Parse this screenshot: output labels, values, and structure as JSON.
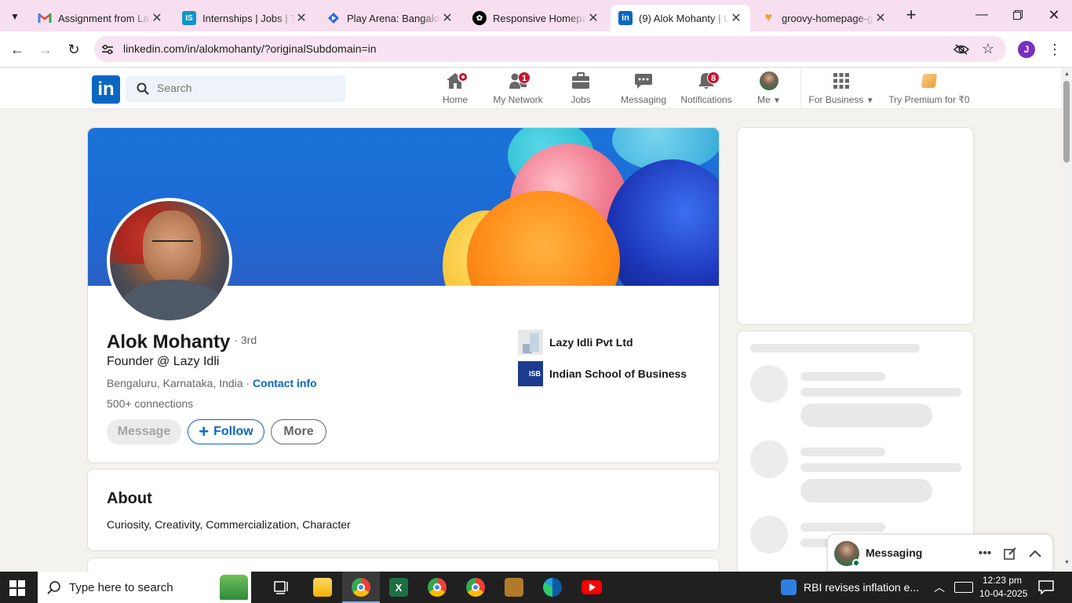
{
  "browser": {
    "tabs": [
      {
        "title": "Assignment from Lazy",
        "favicon": "gmail-icon"
      },
      {
        "title": "Internships | Jobs | Tra",
        "favicon": "internshala-icon"
      },
      {
        "title": "Play Arena: Bangalore",
        "favicon": "playarena-icon"
      },
      {
        "title": "Responsive Homepag",
        "favicon": "chatgpt-icon"
      },
      {
        "title": "(9) Alok Mohanty | Li",
        "favicon": "linkedin-icon",
        "active": true
      },
      {
        "title": "groovy-homepage-g",
        "favicon": "heart-icon"
      }
    ],
    "url": "linkedin.com/in/alokmohanty/?originalSubdomain=in",
    "profile_initial": "J"
  },
  "linkedin_nav": {
    "logo": "in",
    "search_placeholder": "Search",
    "items": [
      {
        "label": "Home",
        "icon": "home-icon",
        "badge": ""
      },
      {
        "label": "My Network",
        "icon": "network-icon",
        "badge": "1"
      },
      {
        "label": "Jobs",
        "icon": "briefcase-icon",
        "badge": ""
      },
      {
        "label": "Messaging",
        "icon": "messaging-icon",
        "badge": ""
      },
      {
        "label": "Notifications",
        "icon": "bell-icon",
        "badge": "8"
      },
      {
        "label": "Me",
        "icon": "avatar-icon",
        "badge": ""
      },
      {
        "label": "For Business",
        "icon": "grid-icon",
        "badge": ""
      },
      {
        "label": "Try Premium for ₹0",
        "icon": "premium-icon",
        "badge": ""
      }
    ]
  },
  "profile": {
    "name": "Alok Mohanty",
    "degree": "· 3rd",
    "headline": "Founder @ Lazy Idli",
    "location": "Bengaluru, Karnataka, India",
    "location_sep": "·",
    "contact_info": "Contact info",
    "connections": "500+ connections",
    "buttons": {
      "message": "Message",
      "follow": "Follow",
      "more": "More"
    },
    "experience": [
      {
        "name": "Lazy Idli Pvt Ltd",
        "logo": "company-logo"
      },
      {
        "name": "Indian School of Business",
        "logo_text": "ISB"
      }
    ]
  },
  "about": {
    "heading": "About",
    "text": "Curiosity, Creativity, Commercialization, Character"
  },
  "messaging_widget": {
    "title": "Messaging"
  },
  "taskbar": {
    "search_placeholder": "Type here to search",
    "news": "RBI revises inflation e...",
    "time": "12:23 pm",
    "date": "10-04-2025"
  },
  "colors": {
    "linkedin_blue": "#0a66c2",
    "tab_strip": "#f7dff0",
    "badge_red": "#cb112d"
  }
}
